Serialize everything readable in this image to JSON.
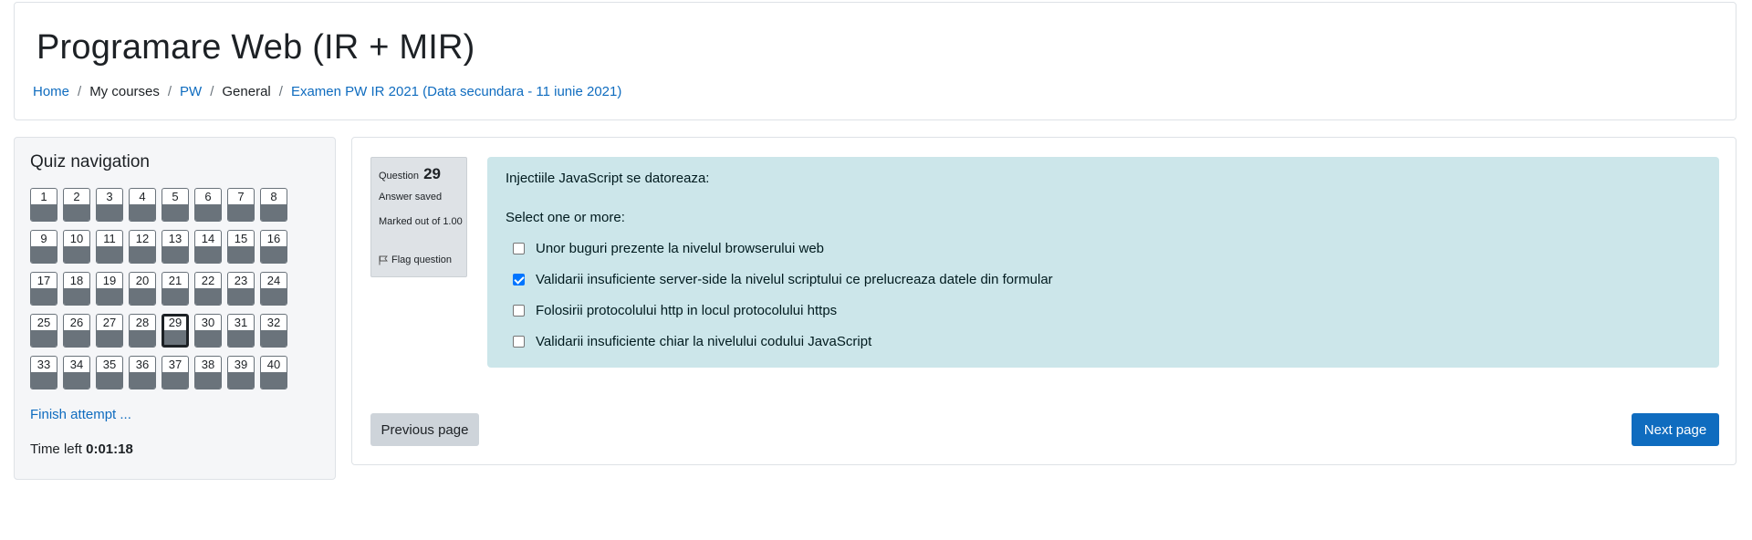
{
  "header": {
    "title": "Programare Web (IR + MIR)",
    "breadcrumb": [
      {
        "label": "Home",
        "link": true
      },
      {
        "label": "My courses",
        "link": false
      },
      {
        "label": "PW",
        "link": true
      },
      {
        "label": "General",
        "link": false
      },
      {
        "label": "Examen PW IR 2021 (Data secundara - 11 iunie 2021)",
        "link": true
      }
    ],
    "separator": "/"
  },
  "quiz_nav": {
    "title": "Quiz navigation",
    "questions": [
      "1",
      "2",
      "3",
      "4",
      "5",
      "6",
      "7",
      "8",
      "9",
      "10",
      "11",
      "12",
      "13",
      "14",
      "15",
      "16",
      "17",
      "18",
      "19",
      "20",
      "21",
      "22",
      "23",
      "24",
      "25",
      "26",
      "27",
      "28",
      "29",
      "30",
      "31",
      "32",
      "33",
      "34",
      "35",
      "36",
      "37",
      "38",
      "39",
      "40"
    ],
    "current": "29",
    "finish_label": "Finish attempt ...",
    "time_left_label": "Time left",
    "time_left_value": "0:01:18",
    "state_color": "#6a737b"
  },
  "question": {
    "label": "Question",
    "number": "29",
    "state": "Answer saved",
    "grade": "Marked out of 1.00",
    "flag_label": "Flag question",
    "flag_icon": "flag-icon",
    "text": "Injectiile JavaScript se datoreaza:",
    "prompt": "Select one or more:",
    "answers": [
      {
        "label": "Unor buguri prezente la nivelul browserului web",
        "checked": false
      },
      {
        "label": "Validarii insuficiente server-side la nivelul scriptului ce prelucreaza datele din formular",
        "checked": true
      },
      {
        "label": "Folosirii protocolului http in locul protocolului https",
        "checked": false
      },
      {
        "label": "Validarii insuficiente chiar la nivelului codului JavaScript",
        "checked": false
      }
    ],
    "content_bg": "#cce6ea"
  },
  "navigation": {
    "prev_label": "Previous page",
    "next_label": "Next page",
    "accent": "#0f6cbf"
  }
}
